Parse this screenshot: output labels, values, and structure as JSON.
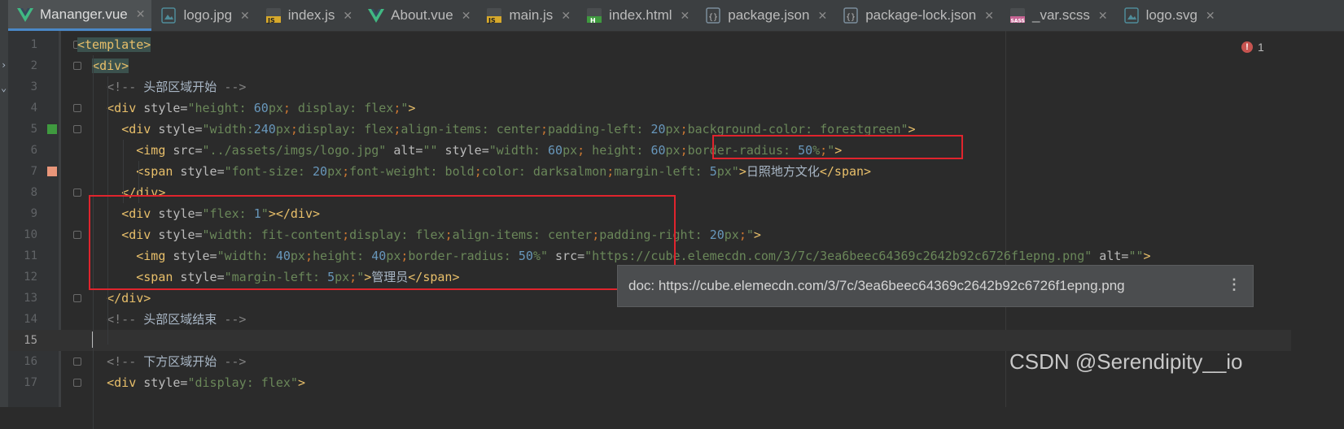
{
  "tabs": [
    {
      "label": "Mananger.vue",
      "icon": "vue-icon",
      "active": true
    },
    {
      "label": "logo.jpg",
      "icon": "image-icon"
    },
    {
      "label": "index.js",
      "icon": "js-icon"
    },
    {
      "label": "About.vue",
      "icon": "vue-icon"
    },
    {
      "label": "main.js",
      "icon": "js-icon"
    },
    {
      "label": "index.html",
      "icon": "html-icon"
    },
    {
      "label": "package.json",
      "icon": "json-icon"
    },
    {
      "label": "package-lock.json",
      "icon": "json-icon"
    },
    {
      "label": "_var.scss",
      "icon": "sass-icon"
    },
    {
      "label": "logo.svg",
      "icon": "image-icon"
    }
  ],
  "tab_close_glyph": "✕",
  "colors": {
    "vue": "#41b883",
    "js": "#d7a92b",
    "html": "#3f9a3f",
    "json": "#7b8d9c",
    "sass": "#c76494",
    "image": "#4f8c99",
    "error": "#c75450",
    "annotation": "#e0242d"
  },
  "error_indicator": {
    "icon": "error-icon",
    "glyph": "!",
    "count": "1"
  },
  "current_line": 15,
  "lines": [
    {
      "n": "1",
      "tokens": [
        [
          "tag",
          "<template>"
        ]
      ],
      "hl": true
    },
    {
      "n": "2",
      "tokens": [
        [
          "sp",
          "  "
        ],
        [
          "tag",
          "<div>"
        ]
      ],
      "hl": true
    },
    {
      "n": "3",
      "tokens": [
        [
          "sp",
          "    "
        ],
        [
          "com",
          "<!-- "
        ],
        [
          "cjk",
          "头部区域开始"
        ],
        [
          "com",
          " -->"
        ]
      ]
    },
    {
      "n": "4",
      "tokens": [
        [
          "sp",
          "    "
        ],
        [
          "tag",
          "<div"
        ],
        [
          "attr",
          " style="
        ],
        [
          "str",
          "\"height: "
        ],
        [
          "num",
          "60"
        ],
        [
          "str",
          "px"
        ],
        [
          "kw",
          ";"
        ],
        [
          "str",
          " display: flex"
        ],
        [
          "kw",
          ";"
        ],
        [
          "str",
          "\""
        ],
        [
          "tag",
          ">"
        ]
      ]
    },
    {
      "n": "5",
      "marker": "green",
      "tokens": [
        [
          "sp",
          "      "
        ],
        [
          "tag",
          "<div"
        ],
        [
          "attr",
          " style="
        ],
        [
          "str",
          "\"width:"
        ],
        [
          "num",
          "240"
        ],
        [
          "str",
          "px"
        ],
        [
          "kw",
          ";"
        ],
        [
          "str",
          "display: flex"
        ],
        [
          "kw",
          ";"
        ],
        [
          "str",
          "align-items: center"
        ],
        [
          "kw",
          ";"
        ],
        [
          "str",
          "padding-left: "
        ],
        [
          "num",
          "20"
        ],
        [
          "str",
          "px"
        ],
        [
          "kw",
          ";"
        ],
        [
          "str",
          "background-color: forestgreen\""
        ],
        [
          "tag",
          ">"
        ]
      ]
    },
    {
      "n": "6",
      "tokens": [
        [
          "sp",
          "        "
        ],
        [
          "tag",
          "<img"
        ],
        [
          "attr",
          " src="
        ],
        [
          "str",
          "\"../assets/imgs/logo.jpg\""
        ],
        [
          "attr",
          " alt="
        ],
        [
          "str",
          "\"\""
        ],
        [
          "attr",
          " style="
        ],
        [
          "str",
          "\"width: "
        ],
        [
          "num",
          "60"
        ],
        [
          "str",
          "px"
        ],
        [
          "kw",
          ";"
        ],
        [
          "str",
          " height: "
        ],
        [
          "num",
          "60"
        ],
        [
          "str",
          "px"
        ],
        [
          "kw",
          ";"
        ],
        [
          "str",
          "border-radius: "
        ],
        [
          "num",
          "50"
        ],
        [
          "str",
          "%"
        ],
        [
          "kw",
          ";"
        ],
        [
          "str",
          "\""
        ],
        [
          "tag",
          ">"
        ]
      ]
    },
    {
      "n": "7",
      "marker": "salmon",
      "tokens": [
        [
          "sp",
          "        "
        ],
        [
          "tag",
          "<span"
        ],
        [
          "attr",
          " style="
        ],
        [
          "str",
          "\"font-size: "
        ],
        [
          "num",
          "20"
        ],
        [
          "str",
          "px"
        ],
        [
          "kw",
          ";"
        ],
        [
          "str",
          "font-weight: bold"
        ],
        [
          "kw",
          ";"
        ],
        [
          "str",
          "color: darksalmon"
        ],
        [
          "kw",
          ";"
        ],
        [
          "str",
          "margin-left: "
        ],
        [
          "num",
          "5"
        ],
        [
          "str",
          "px\""
        ],
        [
          "tag",
          ">"
        ],
        [
          "cjk",
          "日照地方文化"
        ],
        [
          "tag",
          "</span>"
        ]
      ]
    },
    {
      "n": "8",
      "tokens": [
        [
          "sp",
          "      "
        ],
        [
          "tag",
          "</div>"
        ]
      ]
    },
    {
      "n": "9",
      "tokens": [
        [
          "sp",
          "      "
        ],
        [
          "tag",
          "<div"
        ],
        [
          "attr",
          " style="
        ],
        [
          "str",
          "\"flex: "
        ],
        [
          "num",
          "1"
        ],
        [
          "str",
          "\""
        ],
        [
          "tag",
          "></div>"
        ]
      ]
    },
    {
      "n": "10",
      "tokens": [
        [
          "sp",
          "      "
        ],
        [
          "tag",
          "<div"
        ],
        [
          "attr",
          " style="
        ],
        [
          "str",
          "\"width: fit-content"
        ],
        [
          "kw",
          ";"
        ],
        [
          "str",
          "display: flex"
        ],
        [
          "kw",
          ";"
        ],
        [
          "str",
          "align-items: center"
        ],
        [
          "kw",
          ";"
        ],
        [
          "str",
          "padding-right: "
        ],
        [
          "num",
          "20"
        ],
        [
          "str",
          "px"
        ],
        [
          "kw",
          ";"
        ],
        [
          "str",
          "\""
        ],
        [
          "tag",
          ">"
        ]
      ]
    },
    {
      "n": "11",
      "tokens": [
        [
          "sp",
          "        "
        ],
        [
          "tag",
          "<img"
        ],
        [
          "attr",
          " style="
        ],
        [
          "str",
          "\"width: "
        ],
        [
          "num",
          "40"
        ],
        [
          "str",
          "px"
        ],
        [
          "kw",
          ";"
        ],
        [
          "str",
          "height: "
        ],
        [
          "num",
          "40"
        ],
        [
          "str",
          "px"
        ],
        [
          "kw",
          ";"
        ],
        [
          "str",
          "border-radius: "
        ],
        [
          "num",
          "50"
        ],
        [
          "str",
          "%\""
        ],
        [
          "attr",
          " src="
        ],
        [
          "str",
          "\"https://cube.elemecdn.com/3/7c/3ea6beec64369c2642b92c6726f1epng.png\""
        ],
        [
          "attr",
          " alt="
        ],
        [
          "str",
          "\"\""
        ],
        [
          "tag",
          ">"
        ]
      ]
    },
    {
      "n": "12",
      "tokens": [
        [
          "sp",
          "        "
        ],
        [
          "tag",
          "<span"
        ],
        [
          "attr",
          " style="
        ],
        [
          "str",
          "\"margin-left: "
        ],
        [
          "num",
          "5"
        ],
        [
          "str",
          "px"
        ],
        [
          "kw",
          ";"
        ],
        [
          "str",
          "\""
        ],
        [
          "tag",
          ">"
        ],
        [
          "cjk",
          "管理员"
        ],
        [
          "tag",
          "</span>"
        ]
      ]
    },
    {
      "n": "13",
      "tokens": [
        [
          "sp",
          "    "
        ],
        [
          "tag",
          "</div>"
        ]
      ]
    },
    {
      "n": "14",
      "tokens": [
        [
          "sp",
          "    "
        ],
        [
          "com",
          "<!-- "
        ],
        [
          "cjk",
          "头部区域结束"
        ],
        [
          "com",
          " -->"
        ]
      ]
    },
    {
      "n": "15",
      "tokens": [
        [
          "sp",
          "  "
        ]
      ]
    },
    {
      "n": "16",
      "tokens": [
        [
          "sp",
          "    "
        ],
        [
          "com",
          "<!-- "
        ],
        [
          "cjk",
          "下方区域开始"
        ],
        [
          "com",
          " -->"
        ]
      ]
    },
    {
      "n": "17",
      "tokens": [
        [
          "sp",
          "    "
        ],
        [
          "tag",
          "<div"
        ],
        [
          "attr",
          " style="
        ],
        [
          "str",
          "\"display: flex\""
        ],
        [
          "tag",
          ">"
        ]
      ]
    }
  ],
  "tooltip": {
    "text": "doc: https://cube.elemecdn.com/3/7c/3ea6beec64369c2642b92c6726f1epng.png",
    "more_glyph": "⋮"
  },
  "watermark": "CSDN @Serendipity__io"
}
